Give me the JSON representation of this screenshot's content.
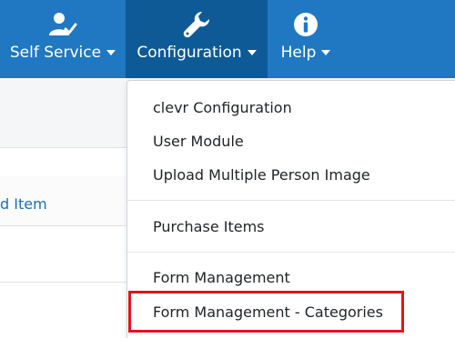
{
  "navbar": {
    "items": [
      {
        "label": "Self Service",
        "icon": "user-check-icon"
      },
      {
        "label": "Configuration",
        "icon": "wrench-icon"
      },
      {
        "label": "Help",
        "icon": "info-circle-icon"
      }
    ]
  },
  "page": {
    "row_link_text": "d Item"
  },
  "dropdown": {
    "items": [
      {
        "label": "clevr Configuration"
      },
      {
        "label": "User Module"
      },
      {
        "label": "Upload Multiple Person Image"
      },
      {
        "label": "Purchase Items"
      },
      {
        "label": "Form Management"
      },
      {
        "label": "Form Management - Categories",
        "highlighted": true
      }
    ]
  },
  "colors": {
    "navbar": "#1f78c1",
    "navbar_active": "#0e5a97",
    "link": "#1f6fb5",
    "highlight": "#e3131b"
  }
}
